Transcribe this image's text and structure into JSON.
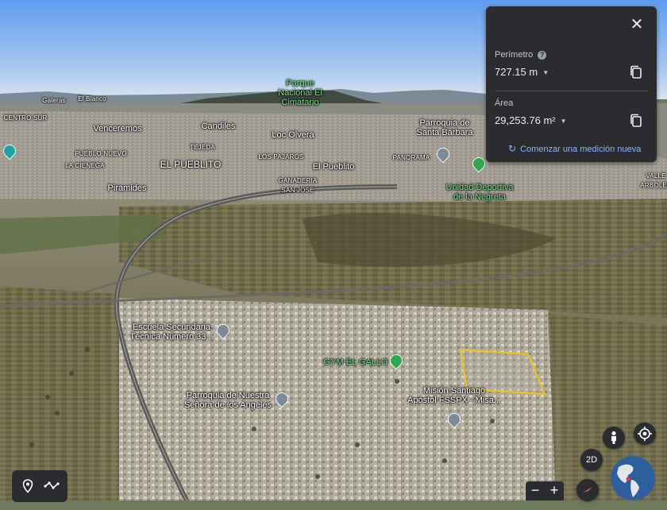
{
  "map": {
    "labels": [
      {
        "id": "galeras",
        "text": "Galeras",
        "cls": "small"
      },
      {
        "id": "el-blanco",
        "text": "El Blanco",
        "cls": "small"
      },
      {
        "id": "centro-sur",
        "text": "CENTRO SUR",
        "cls": "small"
      },
      {
        "id": "parque-nacional",
        "text": "Parque\nNacional El\nCimatario",
        "cls": "green"
      },
      {
        "id": "venceremos",
        "text": "Venceremos",
        "cls": ""
      },
      {
        "id": "candiles",
        "text": "Candiles",
        "cls": ""
      },
      {
        "id": "loc-olvera",
        "text": "Loc Olvera",
        "cls": ""
      },
      {
        "id": "parroquia-santa-barbara",
        "text": "Parroquia de\nSanta Bárbara",
        "cls": ""
      },
      {
        "id": "pueblo-nuevo",
        "text": "PUEBLO NUEVO",
        "cls": "small"
      },
      {
        "id": "tejeda",
        "text": "TEJEDA",
        "cls": "small"
      },
      {
        "id": "los-pajaros",
        "text": "LOS PAJAROS",
        "cls": "small"
      },
      {
        "id": "panorama",
        "text": "PANORAMA",
        "cls": "small"
      },
      {
        "id": "la-cienega",
        "text": "LA CIENEGA",
        "cls": "small"
      },
      {
        "id": "el-pueblito-caps",
        "text": "EL PUEBLITO",
        "cls": "big"
      },
      {
        "id": "el-pueblito",
        "text": "El Pueblito",
        "cls": ""
      },
      {
        "id": "ganaderia",
        "text": "GANADERIA\nSAN JOSE",
        "cls": "small"
      },
      {
        "id": "unidad-deportiva",
        "text": "Unidad Deportiva\nde la Negreta",
        "cls": "green"
      },
      {
        "id": "piramides",
        "text": "Piramides",
        "cls": ""
      },
      {
        "id": "valle-arboledas",
        "text": "VALLE\nARBOLEE",
        "cls": "small"
      },
      {
        "id": "escuela",
        "text": "Escuela Secundaria\nTécnica Número 33...",
        "cls": ""
      },
      {
        "id": "gym",
        "text": "GYM EL GALLO",
        "cls": "green"
      },
      {
        "id": "mision",
        "text": "Misión Santiago\nApóstol FSSPX - Misa...",
        "cls": ""
      },
      {
        "id": "parroquia-angeles",
        "text": "Parroquia de Nuestra\nSeñora de los Angeles",
        "cls": ""
      }
    ]
  },
  "measure": {
    "perimeter_label": "Perímetro",
    "perimeter_value": "727.15 m",
    "area_label": "Área",
    "area_value": "29,253.76 m²",
    "new_measure_label": "Comenzar una medición nueva",
    "accent_color": "#8ab4f8"
  },
  "controls": {
    "view_mode_label": "2D"
  },
  "icons": {
    "close": "close-icon",
    "help": "help-icon",
    "copy": "copy-icon",
    "refresh": "refresh-icon",
    "place": "location-pin-icon",
    "path": "path-icon",
    "pegman": "pegman-icon",
    "my_location": "my-location-icon",
    "compass": "compass-icon",
    "zoom_out": "minus-icon",
    "zoom_in": "plus-icon",
    "globe": "globe-icon"
  }
}
